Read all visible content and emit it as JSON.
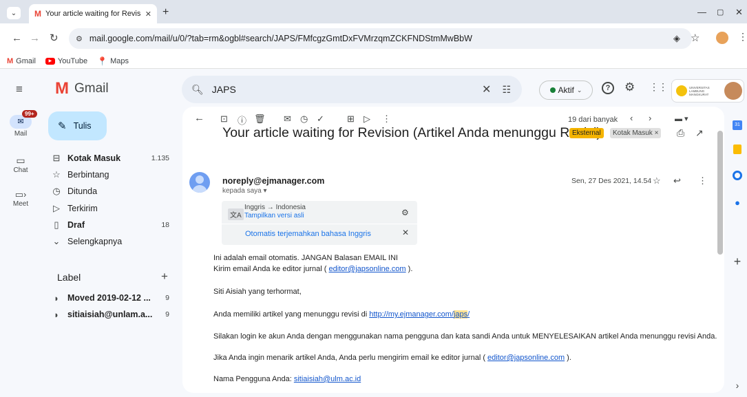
{
  "browser": {
    "tab_title": "Your article waiting for Revision",
    "url": "mail.google.com/mail/u/0/?tab=rm&ogbl#search/JAPS/FMfcgzGmtDxFVMrzqmZCKFNDStmMwBbW",
    "bookmarks": [
      "Gmail",
      "YouTube",
      "Maps"
    ]
  },
  "header": {
    "app_name": "Gmail",
    "search_value": "JAPS",
    "status_label": "Aktif",
    "org_label": "UNIVERSITAS LAMBUNG MANGKURAT"
  },
  "rail": {
    "mail_badge": "99+",
    "items": [
      "Mail",
      "Chat",
      "Meet"
    ]
  },
  "sidebar": {
    "compose_label": "Tulis",
    "items": [
      {
        "label": "Kotak Masuk",
        "count": "1.135"
      },
      {
        "label": "Berbintang",
        "count": ""
      },
      {
        "label": "Ditunda",
        "count": ""
      },
      {
        "label": "Terkirim",
        "count": ""
      },
      {
        "label": "Draf",
        "count": "18"
      },
      {
        "label": "Selengkapnya",
        "count": ""
      }
    ],
    "label_heading": "Label",
    "labels": [
      {
        "label": "Moved 2019-02-12 ...",
        "count": "9"
      },
      {
        "label": "sitiaisiah@unlam.a...",
        "count": "9"
      }
    ]
  },
  "toolbar": {
    "pagination": "19 dari banyak"
  },
  "email": {
    "subject": "Your article waiting for Revision (Artikel Anda menunggu Revisi)",
    "badge_external": "Eksternal",
    "badge_inbox": "Kotak Masuk",
    "sender": "noreply@ejmanager.com",
    "to": "kepada saya",
    "date": "Sen, 27 Des 2021, 14.54",
    "translate": {
      "langs": "Inggris → Indonesia",
      "show_original": "Tampilkan versi asli",
      "auto_translate": "Otomatis terjemahkan bahasa Inggris"
    },
    "body": {
      "line1": "Ini adalah email otomatis. JANGAN Balasan EMAIL INI",
      "line2_pre": "Kirim email Anda ke editor jurnal (",
      "editor_email": "editor@japsonline.com",
      "line2_post": ").",
      "greeting": "Siti Aisiah yang terhormat,",
      "para1_pre": "Anda memiliki artikel yang menunggu revisi di",
      "para1_link": "http://my.ejmanager.com/",
      "para1_link_hl": "japs",
      "para1_post": "/",
      "para2": "Silakan login ke akun Anda dengan menggunakan nama pengguna dan kata sandi Anda untuk MENYELESAIKAN artikel Anda menunggu revisi Anda.",
      "para3_pre": "Jika Anda ingin menarik artikel Anda, Anda perlu mengirim email ke editor jurnal (",
      "para3_email": "editor@japsonline.com",
      "para3_post": ").",
      "username_pre": "Nama Pengguna Anda:",
      "username": "sitiaisiah@ulm.ac.id"
    }
  },
  "colors": {
    "accent_blue": "#0b57d0",
    "external_badge": "#f5b400",
    "active_green": "#188038"
  }
}
